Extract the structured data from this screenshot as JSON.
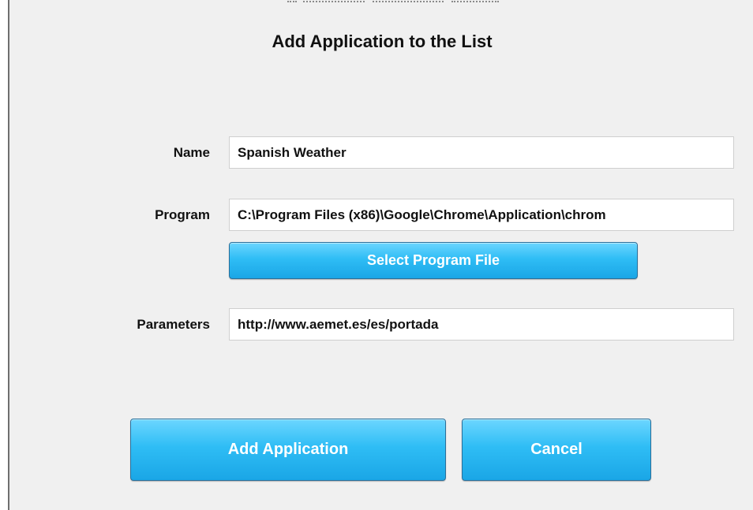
{
  "dialog": {
    "title": "Add Application to the List"
  },
  "form": {
    "name_label": "Name",
    "name_value": "Spanish Weather",
    "program_label": "Program",
    "program_value": "C:\\Program Files (x86)\\Google\\Chrome\\Application\\chrom",
    "select_program_label": "Select Program File",
    "parameters_label": "Parameters",
    "parameters_value": "http://www.aemet.es/es/portada"
  },
  "actions": {
    "add_label": "Add Application",
    "cancel_label": "Cancel"
  },
  "colors": {
    "button_top": "#6cd6ff",
    "button_bottom": "#1aa6e6",
    "dialog_bg": "#f0f0f0"
  }
}
